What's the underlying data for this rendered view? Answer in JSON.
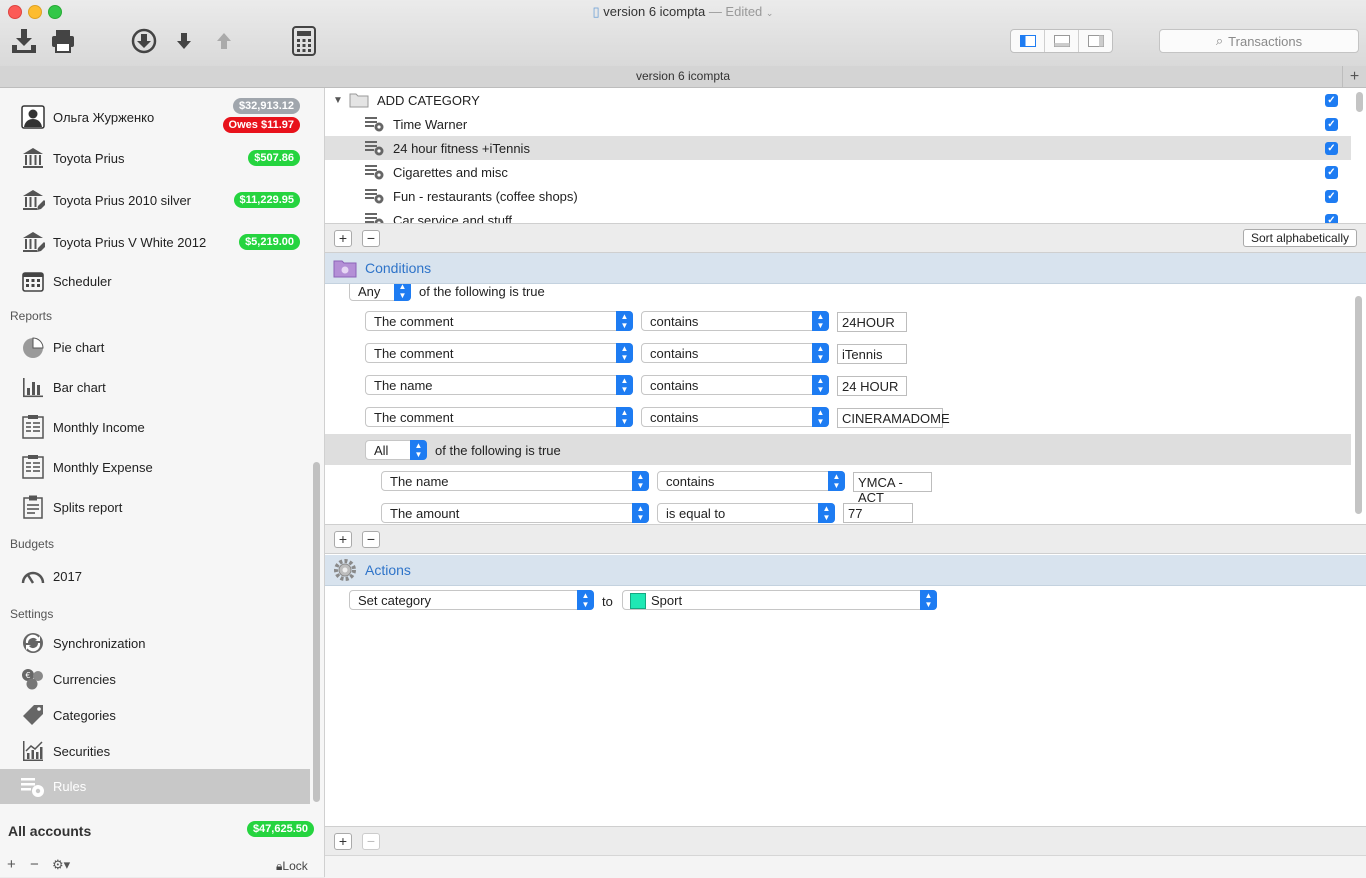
{
  "window": {
    "title": "version 6 icompta",
    "edited": "— Edited",
    "tab_title": "version 6 icompta"
  },
  "toolbar": {
    "search_placeholder": "Transactions"
  },
  "colors": {
    "accent": "#1e7cf2",
    "green_badge": "#25d43f",
    "red_badge": "#e8121b",
    "section_bg": "#d8e3ee",
    "selection": "#c8c8c8",
    "sport_swatch": "#1ee8b4"
  },
  "sidebar": {
    "accounts": [
      {
        "name": "Ольга Журженко",
        "balance": "$32,913.12",
        "owes": "Owes $11.97",
        "icon": "person-icon"
      },
      {
        "name": "Toyota Prius",
        "balance": "$507.86",
        "icon": "bank-icon"
      },
      {
        "name": "Toyota Prius 2010 silver",
        "balance": "$11,229.95",
        "icon": "bank-edit-icon"
      },
      {
        "name": "Toyota Prius V White 2012",
        "balance": "$5,219.00",
        "icon": "bank-edit-icon"
      },
      {
        "name": "Scheduler",
        "icon": "calendar-icon"
      }
    ],
    "reports_header": "Reports",
    "reports": [
      "Pie chart",
      "Bar chart",
      "Monthly Income",
      "Monthly Expense",
      "Splits report"
    ],
    "budgets_header": "Budgets",
    "budgets": [
      "2017"
    ],
    "settings_header": "Settings",
    "settings": [
      "Synchronization",
      "Currencies",
      "Categories",
      "Securities",
      "Rules"
    ],
    "all_accounts": "All accounts",
    "all_accounts_balance": "$47,625.50",
    "lock": "Lock"
  },
  "categories": {
    "root": "ADD CATEGORY",
    "items": [
      "Time Warner",
      "24 hour fitness +iTennis",
      "Cigarettes and misc",
      "Fun - restaurants (coffee shops)",
      "Car service and stuff"
    ],
    "sort_button": "Sort alphabetically"
  },
  "conditions": {
    "title": "Conditions",
    "top_quantifier": "Any",
    "top_suffix": "of the following is true",
    "rows": [
      {
        "field": "The comment",
        "op": "contains",
        "value": "24HOUR"
      },
      {
        "field": "The comment",
        "op": "contains",
        "value": "iTennis"
      },
      {
        "field": "The name",
        "op": "contains",
        "value": "24 HOUR"
      },
      {
        "field": "The comment",
        "op": "contains",
        "value": "CINERAMADOME"
      }
    ],
    "group_quantifier": "All",
    "group_suffix": "of the following is true",
    "group_rows": [
      {
        "field": "The name",
        "op": "contains",
        "value": "YMCA - ACT"
      },
      {
        "field": "The amount",
        "op": "is equal to",
        "value": "77"
      }
    ]
  },
  "actions": {
    "title": "Actions",
    "action": "Set category",
    "to": "to",
    "target": "Sport"
  }
}
